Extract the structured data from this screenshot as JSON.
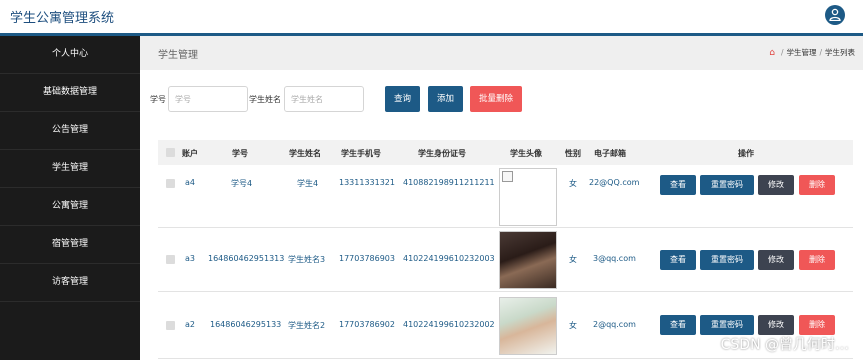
{
  "app": {
    "title": "学生公寓管理系统"
  },
  "sidebar": {
    "items": [
      {
        "label": "个人中心"
      },
      {
        "label": "基础数据管理"
      },
      {
        "label": "公告管理"
      },
      {
        "label": "学生管理"
      },
      {
        "label": "公寓管理"
      },
      {
        "label": "宿管管理"
      },
      {
        "label": "访客管理"
      }
    ]
  },
  "page": {
    "title": "学生管理",
    "breadcrumb": [
      "学生管理",
      "学生列表"
    ]
  },
  "search": {
    "student_no_label": "学号",
    "student_no_placeholder": "学号",
    "student_name_label": "学生姓名",
    "student_name_placeholder": "学生姓名",
    "query_label": "查询",
    "add_label": "添加",
    "batch_delete_label": "批量删除"
  },
  "table": {
    "columns": [
      "账户",
      "学号",
      "学生姓名",
      "学生手机号",
      "学生身份证号",
      "学生头像",
      "性别",
      "电子邮箱",
      "操作"
    ],
    "rows": [
      {
        "account": "a4",
        "student_no": "学号4",
        "name": "学生4",
        "phone": "13311331321",
        "id_card": "410882198911211211",
        "photo": "broken-image",
        "gender": "女",
        "email": "22@QQ.com"
      },
      {
        "account": "a3",
        "student_no": "164860462951313",
        "name": "学生姓名3",
        "phone": "17703786903",
        "id_card": "410224199610232003",
        "photo": "portrait-dark",
        "gender": "女",
        "email": "3@qq.com"
      },
      {
        "account": "a2",
        "student_no": "16486046295133",
        "name": "学生姓名2",
        "phone": "17703786902",
        "id_card": "410224199610232002",
        "photo": "portrait-light",
        "gender": "女",
        "email": "2@qq.com"
      }
    ],
    "actions": {
      "view": "查看",
      "reset_password": "重置密码",
      "edit": "修改",
      "delete": "删除"
    }
  },
  "watermark": "CSDN @曾几何时…",
  "colors": {
    "primary": "#1d5a86",
    "danger": "#f05757",
    "edit": "#3d4350",
    "sidebar": "#1b1b1b"
  }
}
